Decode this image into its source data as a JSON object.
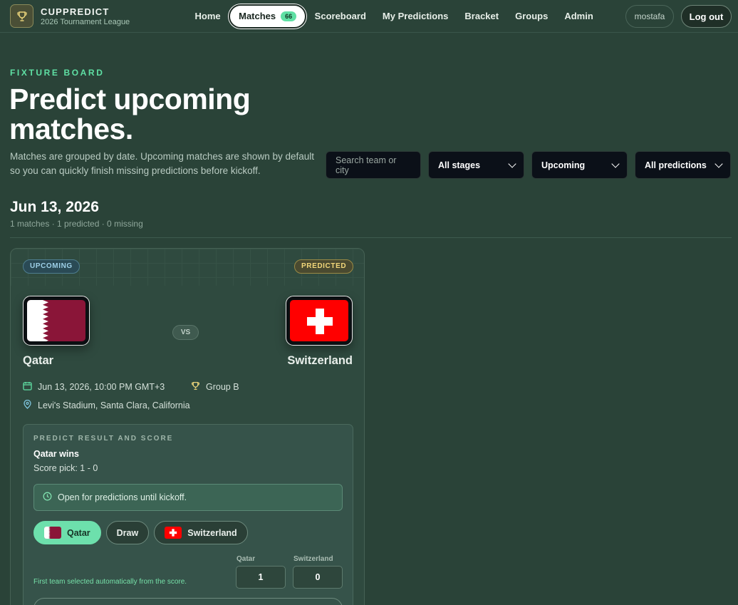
{
  "nav": {
    "brand_name": "CUPPREDICT",
    "brand_sub": "2026 Tournament League",
    "links": [
      "Home",
      "Matches",
      "Scoreboard",
      "My Predictions",
      "Bracket",
      "Groups",
      "Admin"
    ],
    "active_link": "Matches",
    "matches_count": "66",
    "user": "mostafa",
    "logout": "Log out"
  },
  "hero": {
    "eyebrow": "FIXTURE BOARD",
    "title": "Predict upcoming matches.",
    "description": "Matches are grouped by date. Upcoming matches are shown by default so you can quickly finish missing predictions before kickoff."
  },
  "filters": {
    "search_placeholder": "Search team or city",
    "stage": "All stages",
    "status": "Upcoming",
    "predictions": "All predictions"
  },
  "date_group": {
    "date": "Jun 13, 2026",
    "summary": "1 matches · 1 predicted · 0 missing"
  },
  "match": {
    "status_badge": "UPCOMING",
    "prediction_badge": "PREDICTED",
    "home_team": "Qatar",
    "away_team": "Switzerland",
    "vs": "VS",
    "kickoff": "Jun 13, 2026, 10:00 PM GMT+3",
    "group": "Group B",
    "venue": "Levi's Stadium, Santa Clara, California",
    "predict": {
      "eyebrow": "PREDICT RESULT AND SCORE",
      "pick": "Qatar wins",
      "score_pick": "Score pick: 1 - 0",
      "open_note": "Open for predictions until kickoff.",
      "choices": [
        "Qatar",
        "Draw",
        "Switzerland"
      ],
      "selected": "Qatar",
      "home_label": "Qatar",
      "away_label": "Switzerland",
      "home_score": "1",
      "away_score": "0",
      "auto_note": "First team selected automatically from the score."
    }
  },
  "colors": {
    "background": "#2a4338",
    "accent": "#5fe0a4",
    "qatar_maroon": "#8a1538",
    "swiss_red": "#ff0000"
  }
}
